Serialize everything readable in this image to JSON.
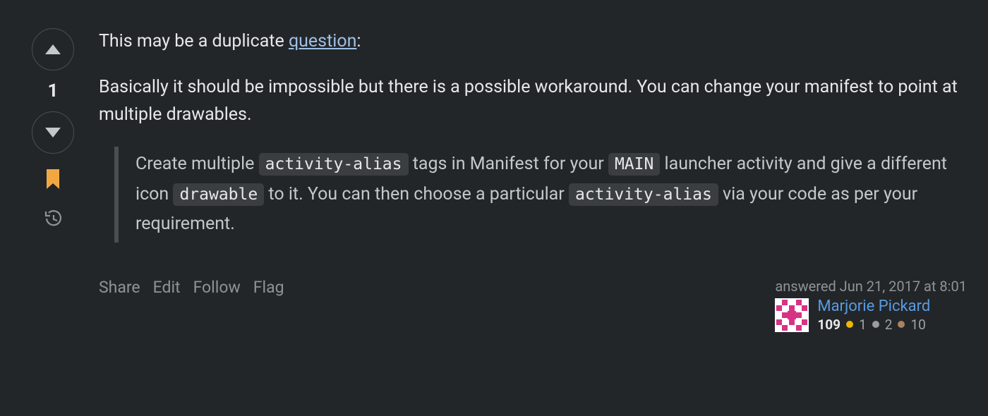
{
  "vote": {
    "score": "1"
  },
  "body": {
    "intro_prefix": "This may be a duplicate ",
    "intro_link": "question",
    "intro_suffix": ":",
    "paragraph": "Basically it should be impossible but there is a possible workaround. You can change your manifest to point at multiple drawables.",
    "quote": {
      "t1": "Create multiple ",
      "c1": "activity-alias",
      "t2": " tags in Manifest for your ",
      "c2": "MAIN",
      "t3": " launcher activity and give a different icon ",
      "c3": "drawable",
      "t4": " to it. You can then choose a particular ",
      "c4": "activity-alias",
      "t5": " via your code as per your requirement."
    }
  },
  "actions": {
    "share": "Share",
    "edit": "Edit",
    "follow": "Follow",
    "flag": "Flag"
  },
  "usercard": {
    "time": "answered Jun 21, 2017 at 8:01",
    "username": "Marjorie Pickard",
    "reputation": "109",
    "gold": "1",
    "silver": "2",
    "bronze": "10"
  }
}
